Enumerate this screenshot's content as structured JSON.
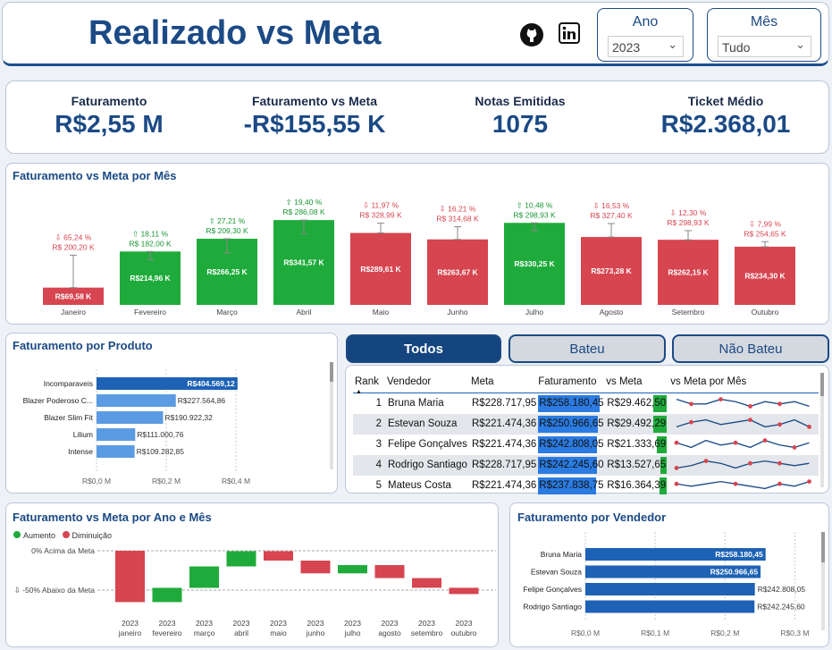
{
  "header": {
    "title": "Realizado vs Meta",
    "year_label": "Ano",
    "year_value": "2023",
    "month_label": "Mês",
    "month_value": "Tudo"
  },
  "kpis": [
    {
      "label": "Faturamento",
      "value": "R$2,55 M"
    },
    {
      "label": "Faturamento vs Meta",
      "value": "-R$155,55 K"
    },
    {
      "label": "Notas Emitidas",
      "value": "1075"
    },
    {
      "label": "Ticket Médio",
      "value": "R$2.368,01"
    }
  ],
  "colors": {
    "green": "#1fab3b",
    "red": "#d64550",
    "blue": "#1d62b5",
    "light_blue": "#5a9be3",
    "navy": "#1b4a85"
  },
  "monthly": {
    "title": "Faturamento vs Meta por Mês",
    "chart_data": {
      "type": "bar",
      "categories": [
        "Janeiro",
        "Fevereiro",
        "Março",
        "Abril",
        "Maio",
        "Junho",
        "Julho",
        "Agosto",
        "Setembro",
        "Outubro"
      ],
      "values": [
        69.58,
        214.96,
        266.25,
        341.57,
        289.61,
        263.67,
        330.25,
        273.28,
        262.15,
        234.3
      ],
      "value_labels": [
        "R$69,58 K",
        "R$214,96 K",
        "R$266,25 K",
        "R$341,57 K",
        "R$289,61 K",
        "R$263,67 K",
        "R$330,25 K",
        "R$273,28 K",
        "R$262,15 K",
        "R$234,30 K"
      ],
      "targets": [
        200.2,
        182.0,
        209.3,
        286.08,
        328.99,
        314.68,
        298.93,
        327.4,
        298.93,
        254.65
      ],
      "target_labels": [
        "R$ 200,20 K",
        "R$ 182,00 K",
        "R$ 209,30 K",
        "R$ 286,08 K",
        "R$ 328,99 K",
        "R$ 314,68 K",
        "R$ 298,93 K",
        "R$ 327,40 K",
        "R$ 298,93 K",
        "R$ 254,65 K"
      ],
      "pct_labels": [
        "⇩ 65,24 %",
        "⇧ 18,11 %",
        "⇧ 27,21 %",
        "⇧ 19,40 %",
        "⇩ 11,97 %",
        "⇩ 16,21 %",
        "⇧ 10,48 %",
        "⇩ 16,53 %",
        "⇩ 12,30 %",
        "⇩ 7,99 %"
      ],
      "status": [
        "down",
        "up",
        "up",
        "up",
        "down",
        "down",
        "up",
        "down",
        "down",
        "down"
      ],
      "ylim": [
        0,
        360
      ]
    }
  },
  "products": {
    "title": "Faturamento por Produto",
    "chart_data": {
      "type": "bar",
      "categories": [
        "Incomparaveis",
        "Blazer Poderoso C...",
        "Blazer Slim Fit",
        "Lilium",
        "Intense"
      ],
      "values": [
        404569.12,
        227564.86,
        190922.32,
        111000.76,
        109282.85
      ],
      "value_labels": [
        "R$404.569,12",
        "R$227.564,86",
        "R$190.922,32",
        "R$111.000,76",
        "R$109.282,85"
      ],
      "xticks": [
        "R$0,0 M",
        "R$0,2 M",
        "R$0,4 M"
      ],
      "xlim": [
        0,
        0.5
      ]
    }
  },
  "tabs": [
    {
      "label": "Todos"
    },
    {
      "label": "Bateu"
    },
    {
      "label": "Não Bateu"
    }
  ],
  "ranking": {
    "columns": [
      "Rank",
      "Vendedor",
      "Meta",
      "Faturamento",
      "vs Meta",
      "vs Meta por Mês"
    ],
    "rows": [
      {
        "rank": "1",
        "vendedor": "Bruna Maria",
        "meta": "R$228.717,95",
        "fat": "R$258.180,45",
        "vs": "R$29.462,50",
        "fat_frac": 0.95,
        "vs_frac": 0.6
      },
      {
        "rank": "2",
        "vendedor": "Estevan Souza",
        "meta": "R$221.474,36",
        "fat": "R$250.966,65",
        "vs": "R$29.492,29",
        "fat_frac": 0.93,
        "vs_frac": 0.6
      },
      {
        "rank": "3",
        "vendedor": "Felipe Gonçalves",
        "meta": "R$221.474,36",
        "fat": "R$242.808,05",
        "vs": "R$21.333,69",
        "fat_frac": 0.91,
        "vs_frac": 0.44
      },
      {
        "rank": "4",
        "vendedor": "Rodrigo Santiago",
        "meta": "R$228.717,95",
        "fat": "R$242.245,60",
        "vs": "R$13.527,65",
        "fat_frac": 0.91,
        "vs_frac": 0.28
      },
      {
        "rank": "5",
        "vendedor": "Mateus Costa",
        "meta": "R$221.474,36",
        "fat": "R$237.838,75",
        "vs": "R$16.364,39",
        "fat_frac": 0.89,
        "vs_frac": 0.33
      }
    ]
  },
  "waterfall": {
    "title": "Faturamento vs Meta por Ano e Mês",
    "legend_up": "Aumento",
    "legend_down": "Diminuição",
    "ref_top": "0% Acima da Meta",
    "ref_bottom": "⇩ -50% Abaixo da Meta",
    "chart_data": {
      "type": "bar",
      "categories": [
        "2023 janeiro",
        "2023 fevereiro",
        "2023 março",
        "2023 abril",
        "2023 maio",
        "2023 junho",
        "2023 julho",
        "2023 agosto",
        "2023 setembro",
        "2023 outubro"
      ],
      "year_labels": [
        "2023",
        "2023",
        "2023",
        "2023",
        "2023",
        "2023",
        "2023",
        "2023",
        "2023",
        "2023"
      ],
      "month_labels": [
        "janeiro",
        "fevereiro",
        "março",
        "abril",
        "maio",
        "junho",
        "julho",
        "agosto",
        "setembro",
        "outubro"
      ],
      "deltas": [
        -65.24,
        18.11,
        27.21,
        19.4,
        -11.97,
        -16.21,
        10.48,
        -16.53,
        -12.3,
        -7.99
      ],
      "ylim": [
        -75,
        5
      ]
    }
  },
  "sellers": {
    "title": "Faturamento por Vendedor",
    "chart_data": {
      "type": "bar",
      "categories": [
        "Bruna Maria",
        "Estevan Souza",
        "Felipe Gonçalves",
        "Rodrigo Santiago"
      ],
      "values": [
        258180.45,
        250966.65,
        242808.05,
        242245.6
      ],
      "value_labels": [
        "R$258.180,45",
        "R$250.966,65",
        "R$242.808,05",
        "R$242.245,60"
      ],
      "xticks": [
        "R$0,0 M",
        "R$0,1 M",
        "R$0,2 M",
        "R$0,3 M"
      ],
      "xlim": [
        0,
        0.32
      ]
    }
  }
}
